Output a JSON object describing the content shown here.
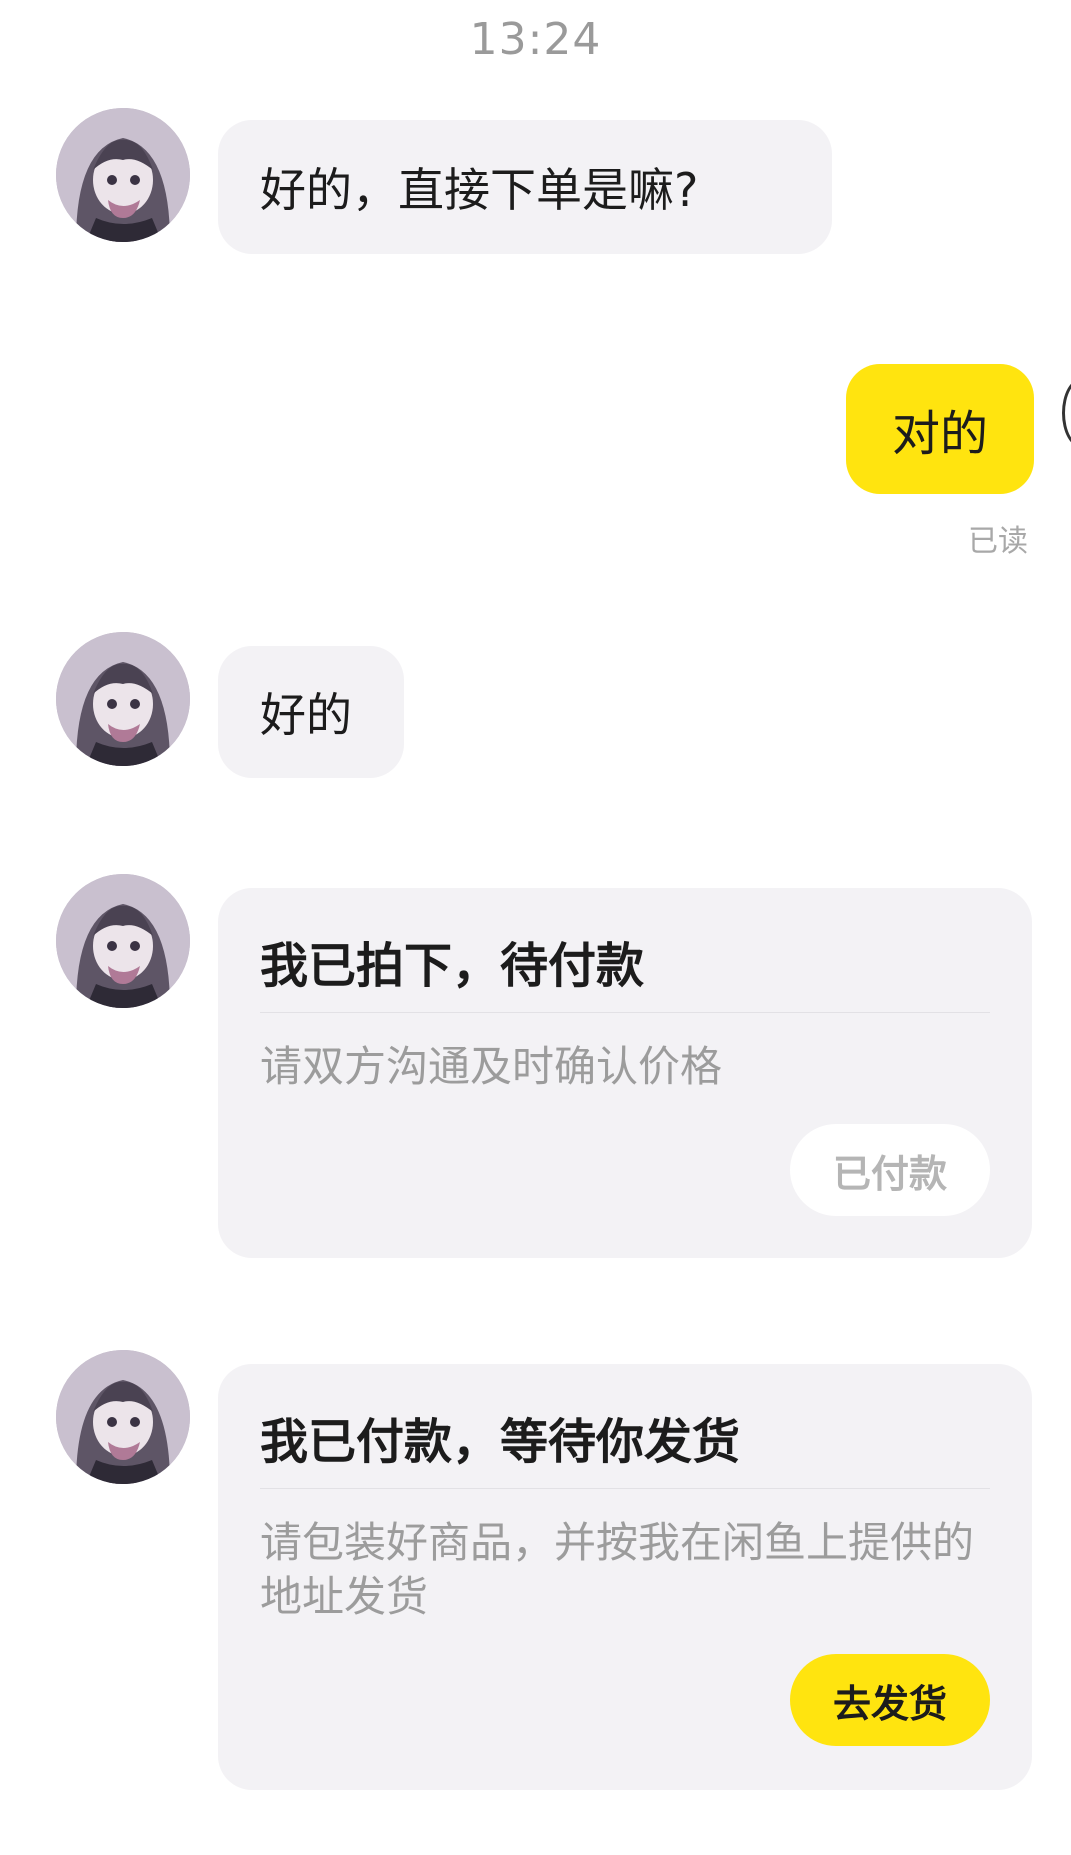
{
  "status_time": "13:24",
  "messages": [
    {
      "from": "other",
      "text": "好的，直接下单是嘛?"
    },
    {
      "from": "me",
      "text": "对的",
      "read_label": "已读"
    },
    {
      "from": "other",
      "text": "好的"
    }
  ],
  "cards": [
    {
      "title": "我已拍下，待付款",
      "desc": "请双方沟通及时确认价格",
      "button": "已付款",
      "button_state": "disabled"
    },
    {
      "title": "我已付款，等待你发货",
      "desc": "请包装好商品，并按我在闲鱼上提供的地址发货",
      "button": "去发货",
      "button_state": "primary"
    }
  ],
  "colors": {
    "accent": "#ffe40f",
    "bubble_in": "#f3f2f5",
    "muted_text": "#9c9c9c"
  },
  "icons": {
    "avatar": "anime-girl-avatar"
  }
}
